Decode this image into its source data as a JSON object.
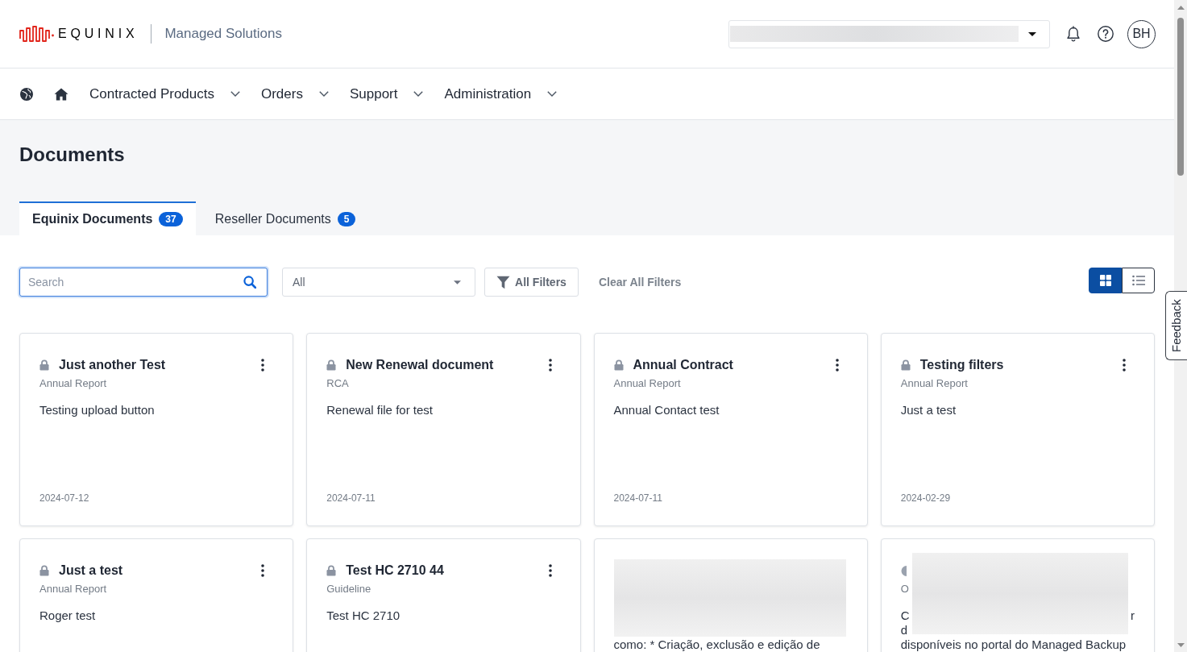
{
  "header": {
    "brand": "EQUINIX",
    "product": "Managed Solutions",
    "avatar": "BH"
  },
  "nav": [
    {
      "label": "Contracted Products"
    },
    {
      "label": "Orders"
    },
    {
      "label": "Support"
    },
    {
      "label": "Administration"
    }
  ],
  "page_title": "Documents",
  "tabs": [
    {
      "label": "Equinix Documents",
      "count": "37",
      "selected": true
    },
    {
      "label": "Reseller Documents",
      "count": "5",
      "selected": false
    }
  ],
  "filters": {
    "search": {
      "placeholder": "Search",
      "focused": true
    },
    "type_select": {
      "value": "All"
    },
    "all_filters": "All Filters",
    "clear_all": "Clear All Filters"
  },
  "view_toggle": [
    {
      "kind": "grid",
      "selected": true
    },
    {
      "kind": "list",
      "selected": false
    }
  ],
  "cards": [
    {
      "kind": "document",
      "title": "Just another Test",
      "category": "Annual Report",
      "description": "Testing upload button",
      "date": "2024-07-12"
    },
    {
      "kind": "document",
      "title": "New Renewal document",
      "category": "RCA",
      "description": "Renewal file for test",
      "date": "2024-07-11"
    },
    {
      "kind": "document",
      "title": "Annual Contract",
      "category": "Annual Report",
      "description": "Annual Contact test",
      "date": "2024-07-11"
    },
    {
      "kind": "document",
      "title": "Testing filters",
      "category": "Annual Report",
      "description": "Just a test",
      "date": "2024-02-29"
    },
    {
      "kind": "document",
      "title": "Just a test",
      "category": "Annual Report",
      "description": "Roger test"
    },
    {
      "kind": "document",
      "title": "Test HC 2710 44",
      "category": "Guideline",
      "description": "Test HC 2710"
    },
    {
      "kind": "redacted",
      "lines": [
        [
          "como: * Criação, exclusão e edição de"
        ]
      ]
    },
    {
      "kind": "partly_redacted",
      "category": "O",
      "lines": [
        [
          "C",
          "r"
        ],
        [
          "d"
        ],
        [
          "disponíveis no portal do Managed Backup"
        ]
      ]
    }
  ],
  "feedback": "Feedback"
}
